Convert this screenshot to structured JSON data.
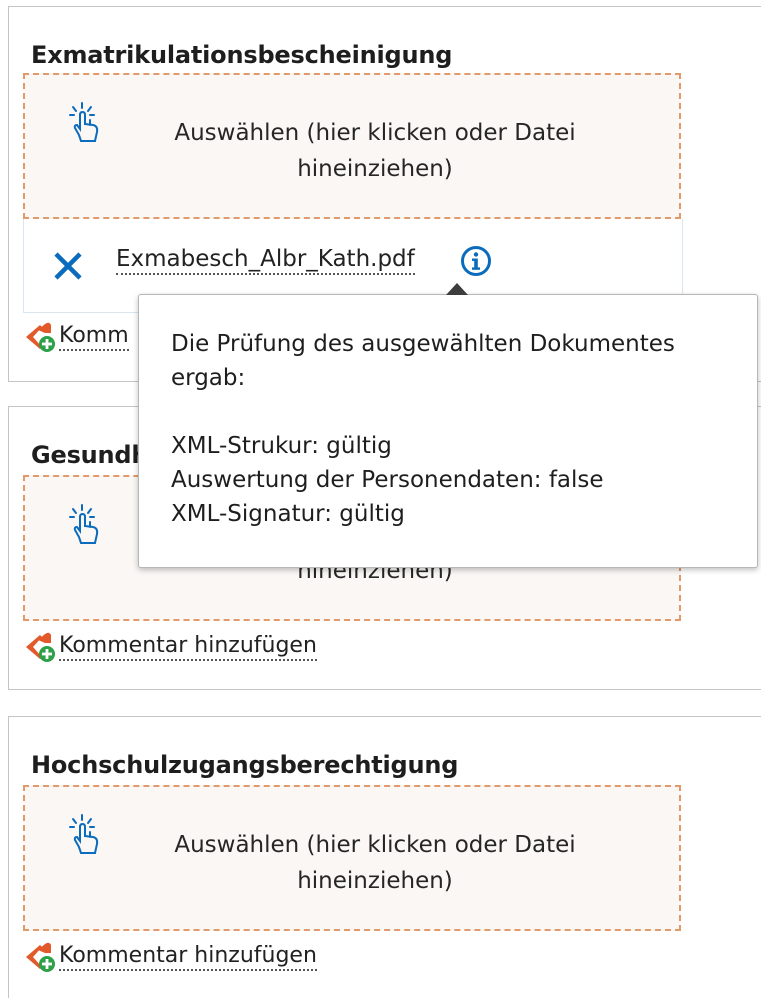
{
  "sections": [
    {
      "title": "Exmatrikulationsbescheinigung",
      "dropzone_text": "Auswählen (hier klicken oder Datei hineinziehen)",
      "file": {
        "name": "Exmabesch_Albr_Kath.pdf"
      },
      "comment_label": "Kommentar hinzufügen"
    },
    {
      "title": "Gesundh",
      "dropzone_text": "hineinziehen)",
      "comment_label": "Kommentar hinzufügen"
    },
    {
      "title": "Hochschulzugangsberechtigung",
      "dropzone_text": "Auswählen (hier klicken oder Datei hineinziehen)",
      "comment_label": "Kommentar hinzufügen"
    }
  ],
  "tooltip": {
    "intro": "Die Prüfung des ausgewählten Dokumentes ergab:",
    "lines": [
      "XML-Strukur: gültig",
      "Auswertung der Personendaten: false",
      "XML-Signatur: gültig"
    ]
  },
  "partial_comment_label": "Komm",
  "icons": {
    "dropzone": "hand-pointer-click-icon",
    "remove": "close-icon",
    "info": "info-circle-icon",
    "comment": "comment-add-icon"
  },
  "colors": {
    "accent_blue": "#0b6cbd",
    "dropzone_border": "#e39a6a",
    "dropzone_bg": "#faf7f5",
    "comment_orange": "#e2592a",
    "comment_green": "#2ea04a"
  }
}
